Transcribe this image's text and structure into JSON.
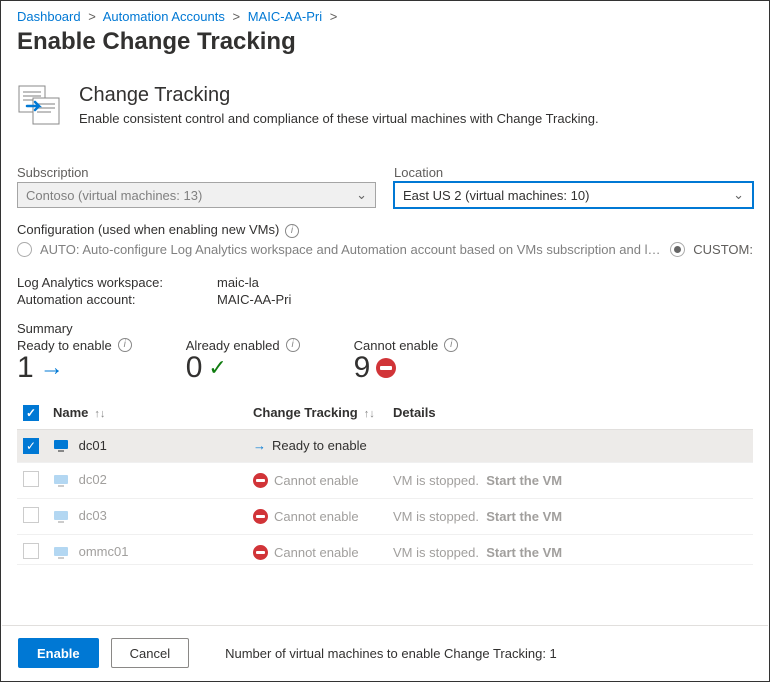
{
  "breadcrumb": {
    "items": [
      "Dashboard",
      "Automation Accounts",
      "MAIC-AA-Pri"
    ]
  },
  "page_title": "Enable Change Tracking",
  "header": {
    "title": "Change Tracking",
    "subtitle": "Enable consistent control and compliance of these virtual machines with Change Tracking."
  },
  "filters": {
    "subscription": {
      "label": "Subscription",
      "value": "Contoso (virtual machines: 13)"
    },
    "location": {
      "label": "Location",
      "value": "East US 2 (virtual machines: 10)"
    }
  },
  "config": {
    "label": "Configuration (used when enabling new VMs)",
    "auto_label": "AUTO: Auto-configure Log Analytics workspace and Automation account based on VMs subscription and location",
    "custom_label": "CUSTOM:"
  },
  "workspace": {
    "log_analytics_label": "Log Analytics workspace:",
    "log_analytics_value": "maic-la",
    "automation_label": "Automation account:",
    "automation_value": "MAIC-AA-Pri"
  },
  "summary": {
    "label": "Summary",
    "ready": {
      "label": "Ready to enable",
      "value": "1"
    },
    "already": {
      "label": "Already enabled",
      "value": "0"
    },
    "cannot": {
      "label": "Cannot enable",
      "value": "9"
    }
  },
  "table": {
    "headers": {
      "name": "Name",
      "change": "Change Tracking",
      "details": "Details"
    },
    "status_ready": "Ready to enable",
    "status_cannot": "Cannot enable",
    "detail_stopped": "VM is stopped.",
    "start_vm": "Start the VM",
    "rows": [
      {
        "name": "dc01",
        "status": "ready",
        "selected": true
      },
      {
        "name": "dc02",
        "status": "cannot",
        "selected": false
      },
      {
        "name": "dc03",
        "status": "cannot",
        "selected": false
      },
      {
        "name": "ommc01",
        "status": "cannot",
        "selected": false
      }
    ]
  },
  "footer": {
    "enable": "Enable",
    "cancel": "Cancel",
    "count_text": "Number of virtual machines to enable Change Tracking: 1"
  }
}
